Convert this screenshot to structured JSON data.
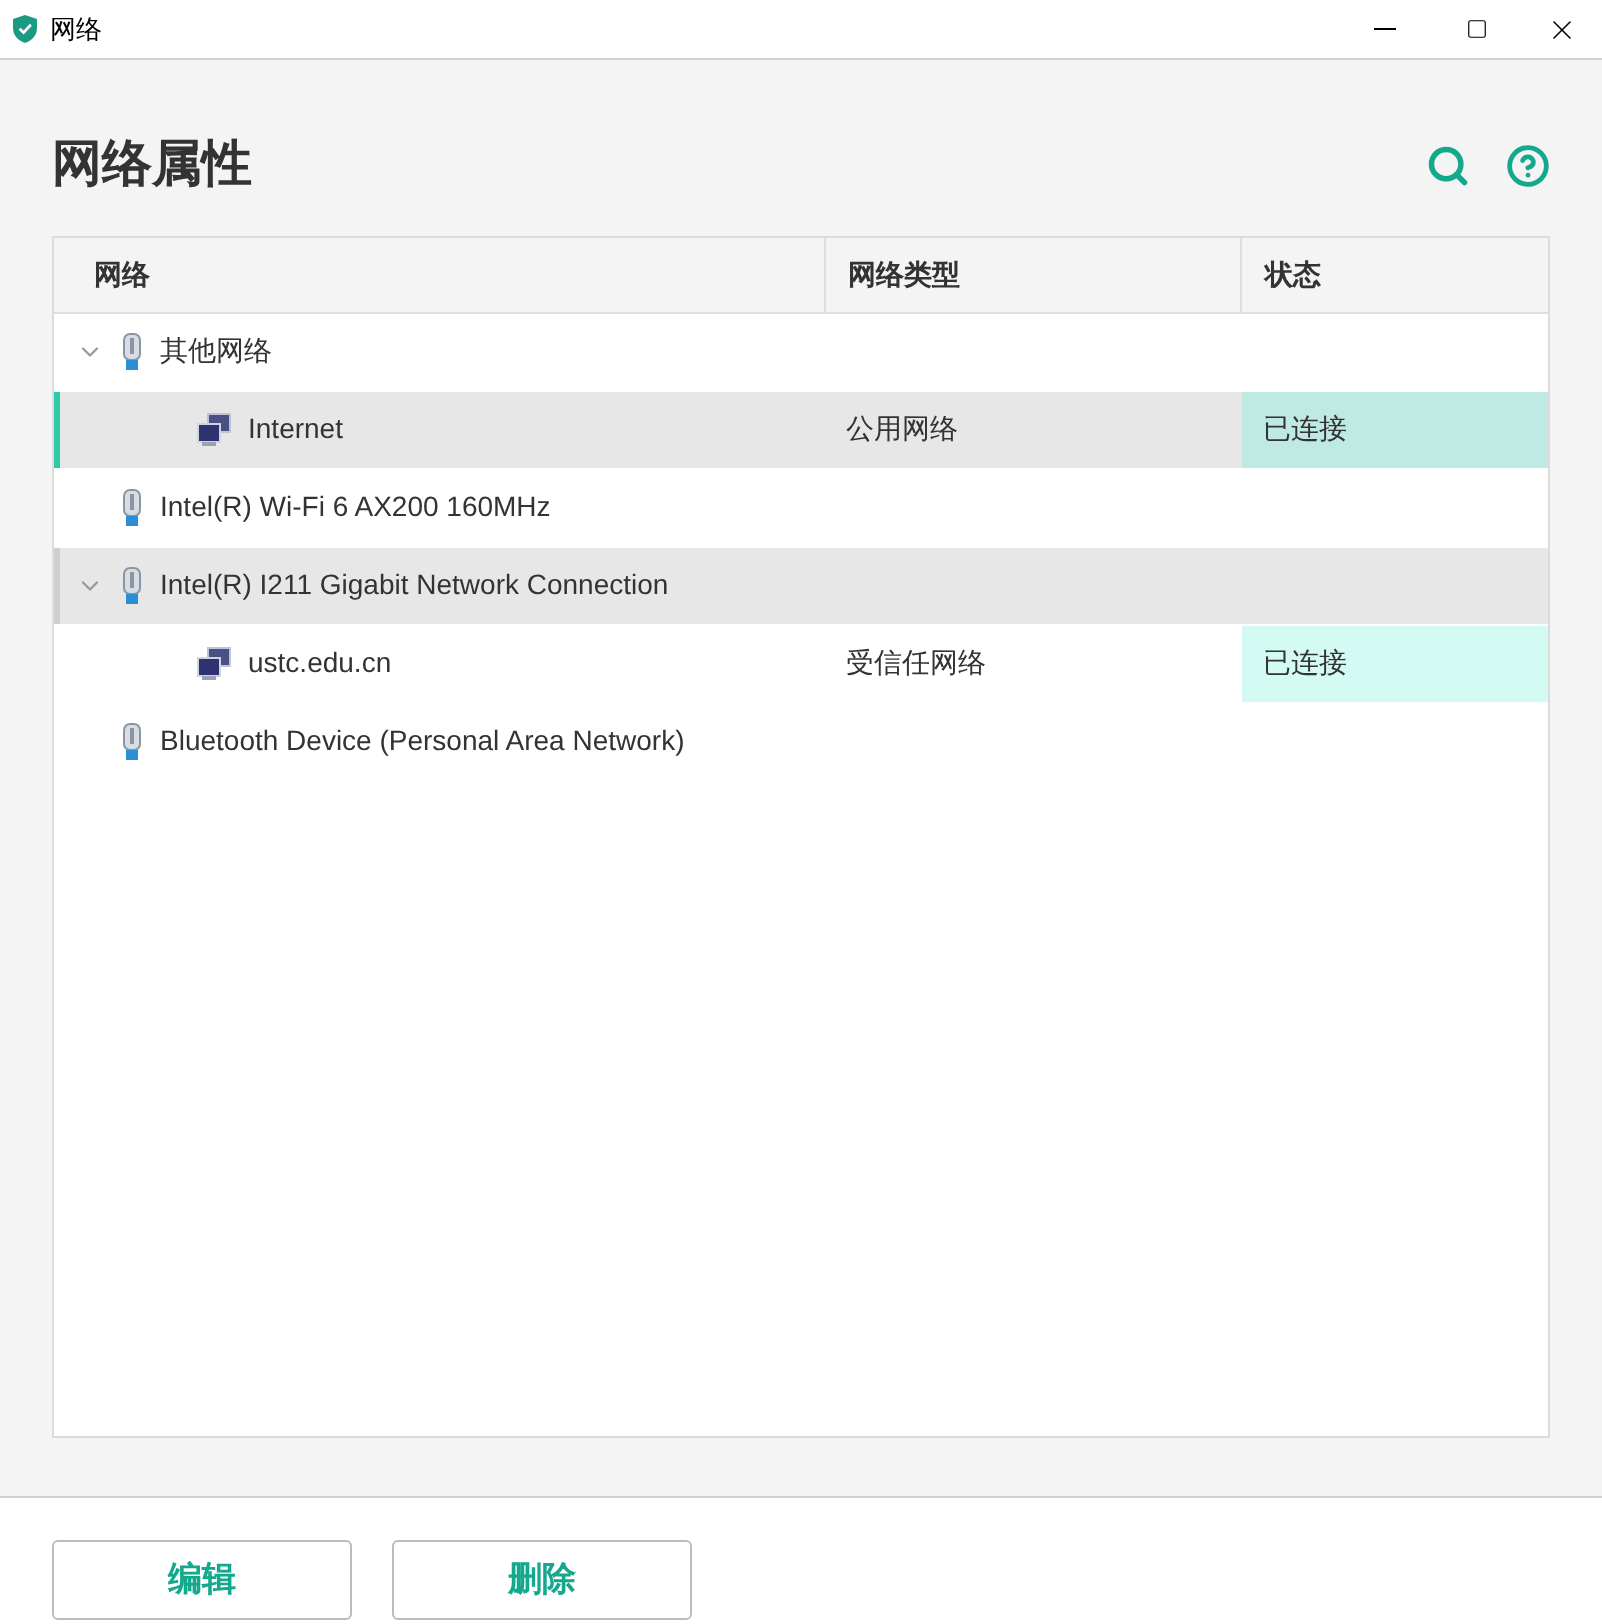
{
  "window": {
    "title": "网络"
  },
  "heading": "网络属性",
  "table": {
    "columns": [
      "网络",
      "网络类型",
      "状态"
    ],
    "rows": [
      {
        "kind": "adapter",
        "name": "其他网络",
        "expanded": true,
        "selected": false,
        "children": [
          {
            "kind": "network",
            "name": "Internet",
            "type": "公用网络",
            "status": "已连接",
            "selected": true
          }
        ]
      },
      {
        "kind": "adapter",
        "name": "Intel(R) Wi-Fi 6 AX200 160MHz",
        "selected": false
      },
      {
        "kind": "adapter",
        "name": "Intel(R) I211 Gigabit Network Connection",
        "expanded": true,
        "selected": false,
        "hovered": true,
        "children": [
          {
            "kind": "network",
            "name": "ustc.edu.cn",
            "type": "受信任网络",
            "status": "已连接",
            "selected": false
          }
        ]
      },
      {
        "kind": "adapter",
        "name": "Bluetooth Device (Personal Area Network)",
        "selected": false
      }
    ]
  },
  "buttons": [
    "编辑",
    "删除"
  ]
}
